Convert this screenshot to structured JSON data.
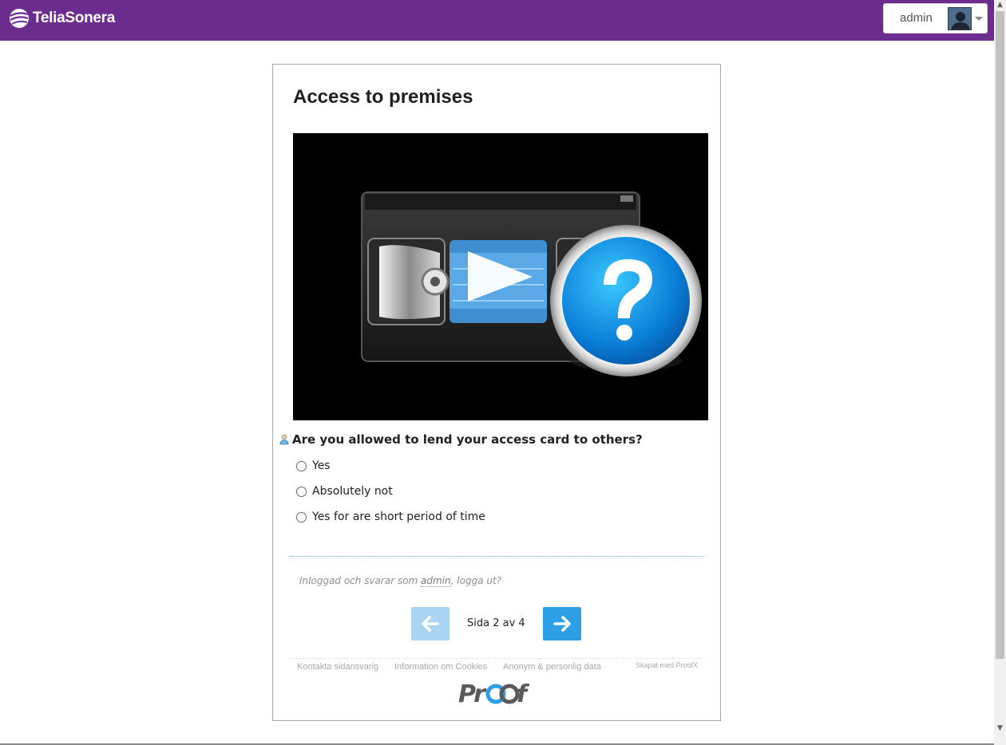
{
  "header": {
    "brand_name": "TeliaSonera",
    "brand_color": "#6b2c8e",
    "user_label": "admin"
  },
  "survey": {
    "title": "Access to premises",
    "video": {
      "description_icons": [
        "video-cassette-icon",
        "play-icon",
        "question-mark-icon"
      ]
    },
    "question": {
      "text": "Are you allowed to lend your access card to others?",
      "options": [
        "Yes",
        "Absolutely not",
        "Yes for are short period of time"
      ]
    },
    "login": {
      "prefix": "Inloggad och svarar som ",
      "user": "admin",
      "separator": ", ",
      "logout": "logga ut?"
    },
    "pager": {
      "prev_icon": "arrow-left-icon",
      "next_icon": "arrow-right-icon",
      "page_text": "Sida 2 av 4",
      "prev_color": "#a9d5f2",
      "next_color": "#2d9fe6"
    },
    "footer": {
      "links": [
        "Kontakta sidansvarig",
        "Information om Cookies",
        "Anonym & personlig data"
      ],
      "made_with": "Skapat med ProofX",
      "logo_text": "ProofX"
    }
  }
}
